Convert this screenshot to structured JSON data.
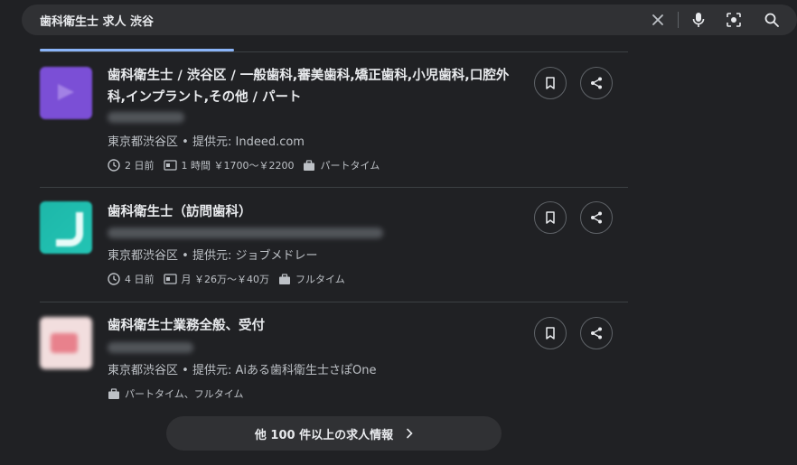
{
  "search": {
    "query": "歯科衛生士 求人 渋谷",
    "icons": [
      "close-icon",
      "mic-icon",
      "lens-icon",
      "search-icon"
    ]
  },
  "jobs": [
    {
      "title": "歯科衛生士 / 渋谷区 / 一般歯科,審美歯科,矯正歯科,小児歯科,口腔外科,インプラント,その他 / パート",
      "location": "東京都渋谷区",
      "provider_label": "提供元:",
      "provider": "Indeed.com",
      "posted": "2 日前",
      "pay": "1 時間 ￥1700～￥2200",
      "type": "パートタイム",
      "logo_color": "#7b4fd6"
    },
    {
      "title": "歯科衛生士（訪問歯科）",
      "location": "東京都渋谷区",
      "provider_label": "提供元:",
      "provider": "ジョブメドレー",
      "posted": "4 日前",
      "pay": "月 ￥26万～￥40万",
      "type": "フルタイム",
      "logo_color": "#1db7a9"
    },
    {
      "title": "歯科衛生士業務全般、受付",
      "location": "東京都渋谷区",
      "provider_label": "提供元:",
      "provider": "Aiある歯科衛生士さぽOne",
      "type": "パートタイム、フルタイム",
      "logo_color": "#f2dede"
    }
  ],
  "more_button": {
    "label": "他 100 件以上の求人情報"
  },
  "colors": {
    "background": "#202124",
    "surface": "#303134",
    "accent": "#8ab4f8",
    "divider": "#3c4043"
  }
}
